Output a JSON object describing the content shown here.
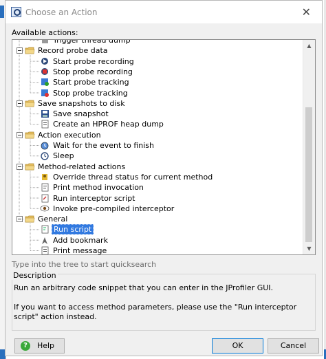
{
  "dialog": {
    "title": "Choose an Action",
    "close_glyph": "✕",
    "available_label": "Available actions:",
    "quicksearch_hint": "Type into the tree to start quicksearch",
    "description_title": "Description",
    "description_p1": "Run an arbitrary code snippet that you can enter in the JProfiler GUI.",
    "description_p2": "If you want to access method parameters, please use the \"Run interceptor script\" action instead.",
    "help_label": "Help",
    "ok_label": "OK",
    "cancel_label": "Cancel"
  },
  "tree": {
    "partial_top": "Trigger thread dump",
    "groups": [
      {
        "label": "Record probe data",
        "items": [
          {
            "label": "Start probe recording",
            "icon": "start-probe-recording-icon"
          },
          {
            "label": "Stop probe recording",
            "icon": "stop-probe-recording-icon"
          },
          {
            "label": "Start probe tracking",
            "icon": "start-probe-tracking-icon"
          },
          {
            "label": "Stop probe tracking",
            "icon": "stop-probe-tracking-icon"
          }
        ]
      },
      {
        "label": "Save snapshots to disk",
        "items": [
          {
            "label": "Save snapshot",
            "icon": "save-snapshot-icon"
          },
          {
            "label": "Create an HPROF heap dump",
            "icon": "hprof-heap-dump-icon"
          }
        ]
      },
      {
        "label": "Action execution",
        "items": [
          {
            "label": "Wait for the event to finish",
            "icon": "wait-event-icon"
          },
          {
            "label": "Sleep",
            "icon": "sleep-icon"
          }
        ]
      },
      {
        "label": "Method-related actions",
        "items": [
          {
            "label": "Override thread status for current method",
            "icon": "override-thread-status-icon"
          },
          {
            "label": "Print method invocation",
            "icon": "print-method-invocation-icon"
          },
          {
            "label": "Run interceptor script",
            "icon": "run-interceptor-script-icon"
          },
          {
            "label": "Invoke pre-compiled interceptor",
            "icon": "invoke-interceptor-icon"
          }
        ]
      },
      {
        "label": "General",
        "items": [
          {
            "label": "Run script",
            "icon": "run-script-icon",
            "selected": true
          },
          {
            "label": "Add bookmark",
            "icon": "add-bookmark-icon"
          },
          {
            "label": "Print message",
            "icon": "print-message-icon"
          }
        ]
      }
    ]
  },
  "colors": {
    "selection": "#3179e0",
    "folder": "#e8c060",
    "ok_border": "#0078d7"
  }
}
